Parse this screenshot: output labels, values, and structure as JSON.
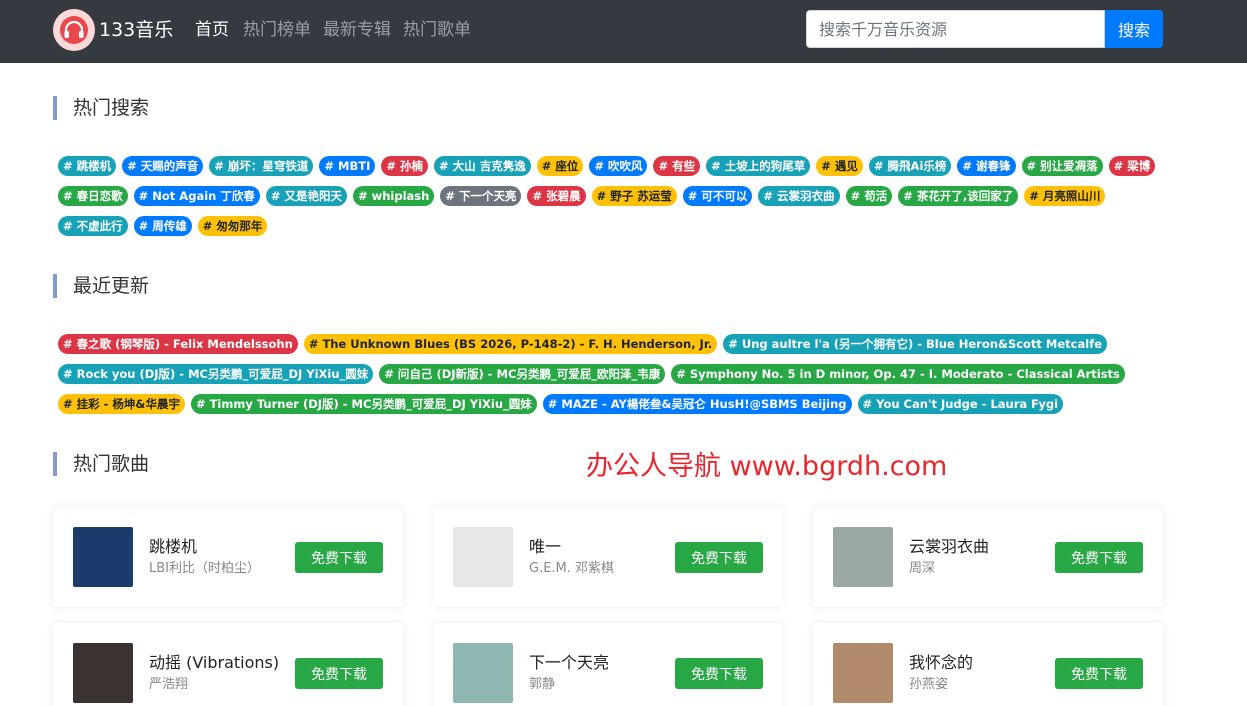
{
  "header": {
    "brand": "133音乐",
    "nav": [
      "首页",
      "热门榜单",
      "最新专辑",
      "热门歌单"
    ],
    "search_placeholder": "搜索千万音乐资源",
    "search_button": "搜索"
  },
  "hot_search": {
    "title": "热门搜索",
    "rows": [
      [
        {
          "label": "# 跳楼机",
          "color": "#17a2b8"
        },
        {
          "label": "# 天赐的声音",
          "color": "#007bff"
        },
        {
          "label": "# 崩坏：星穹铁道",
          "color": "#17a2b8"
        },
        {
          "label": "# MBTI",
          "color": "#007bff"
        },
        {
          "label": "# 孙楠",
          "color": "#dc3545"
        },
        {
          "label": "# 大山 吉克隽逸",
          "color": "#17a2b8"
        },
        {
          "label": "# 座位",
          "color": "#ffc107"
        },
        {
          "label": "# 吹吹风",
          "color": "#007bff"
        },
        {
          "label": "# 有些",
          "color": "#dc3545"
        },
        {
          "label": "# 土坡上的狗尾草",
          "color": "#17a2b8"
        },
        {
          "label": "# 遇见",
          "color": "#ffc107"
        },
        {
          "label": "# 腾飛Ai乐榜",
          "color": "#17a2b8"
        },
        {
          "label": "# 谢春锋",
          "color": "#007bff"
        },
        {
          "label": "# 别让爱凋落",
          "color": "#28a745"
        },
        {
          "label": "# 梁博",
          "color": "#dc3545"
        }
      ],
      [
        {
          "label": "# 春日恋歌",
          "color": "#28a745"
        },
        {
          "label": "# Not Again 丁欣春",
          "color": "#007bff"
        },
        {
          "label": "# 又是艳阳天",
          "color": "#17a2b8"
        },
        {
          "label": "# whiplash",
          "color": "#28a745"
        },
        {
          "label": "# 下一个天亮",
          "color": "#6c757d"
        },
        {
          "label": "# 张碧晨",
          "color": "#dc3545"
        },
        {
          "label": "# 野子 苏运莹",
          "color": "#ffc107"
        },
        {
          "label": "# 可不可以",
          "color": "#007bff"
        },
        {
          "label": "# 云裳羽衣曲",
          "color": "#17a2b8"
        },
        {
          "label": "# 苟活",
          "color": "#28a745"
        },
        {
          "label": "# 茶花开了,该回家了",
          "color": "#28a745"
        },
        {
          "label": "# 月亮照山川",
          "color": "#ffc107"
        }
      ],
      [
        {
          "label": "# 不虚此行",
          "color": "#17a2b8"
        },
        {
          "label": "# 周传雄",
          "color": "#007bff"
        },
        {
          "label": "# 匆匆那年",
          "color": "#ffc107"
        }
      ]
    ]
  },
  "recent": {
    "title": "最近更新",
    "rows": [
      [
        {
          "label": "# 春之歌 (钢琴版) - Felix Mendelssohn",
          "color": "#dc3545"
        },
        {
          "label": "# The Unknown Blues (BS 2026, P-148-2) - F. H. Henderson, Jr.",
          "color": "#ffc107"
        },
        {
          "label": "# Ung aultre l'a (另一个拥有它) - Blue Heron&Scott Metcalfe",
          "color": "#17a2b8"
        }
      ],
      [
        {
          "label": "# Rock you (DJ版) - MC另类鹏_可爱屁_DJ YiXiu_圆妹",
          "color": "#17a2b8"
        },
        {
          "label": "# 问自己 (DJ新版) - MC另类鹏_可爱屁_欧阳泽_韦康",
          "color": "#28a745"
        },
        {
          "label": "# Symphony No. 5 in D minor, Op. 47 - I. Moderato - Classical Artists",
          "color": "#28a745"
        }
      ],
      [
        {
          "label": "# 挂彩 - 杨坤&华晨宇",
          "color": "#ffc107"
        },
        {
          "label": "# Timmy Turner (DJ版) - MC另类鹏_可爱屁_DJ YiXiu_圆妹",
          "color": "#28a745"
        },
        {
          "label": "# MAZE - AY楊佬叁&吴冠仑 HusH!@SBMS Beijing",
          "color": "#007bff"
        },
        {
          "label": "# You Can't Judge - Laura Fygi",
          "color": "#17a2b8"
        }
      ]
    ]
  },
  "hot_songs": {
    "title": "热门歌曲",
    "download_label": "免费下载",
    "songs": [
      {
        "title": "跳楼机",
        "artist": "LBI利比（时柏尘）",
        "cover": "#1c3a6b"
      },
      {
        "title": "唯一",
        "artist": "G.E.M. 邓紫棋",
        "cover": "#e8e6e8"
      },
      {
        "title": "云裳羽衣曲",
        "artist": "周深",
        "cover": "#9aa7a3"
      },
      {
        "title": "动摇 (Vibrations)",
        "artist": "严浩翔",
        "cover": "#3a3330"
      },
      {
        "title": "下一个天亮",
        "artist": "郭静",
        "cover": "#8fb7b2"
      },
      {
        "title": "我怀念的",
        "artist": "孙燕姿",
        "cover": "#b08a6a"
      }
    ]
  },
  "watermark": "办公人导航 www.bgrdh.com"
}
